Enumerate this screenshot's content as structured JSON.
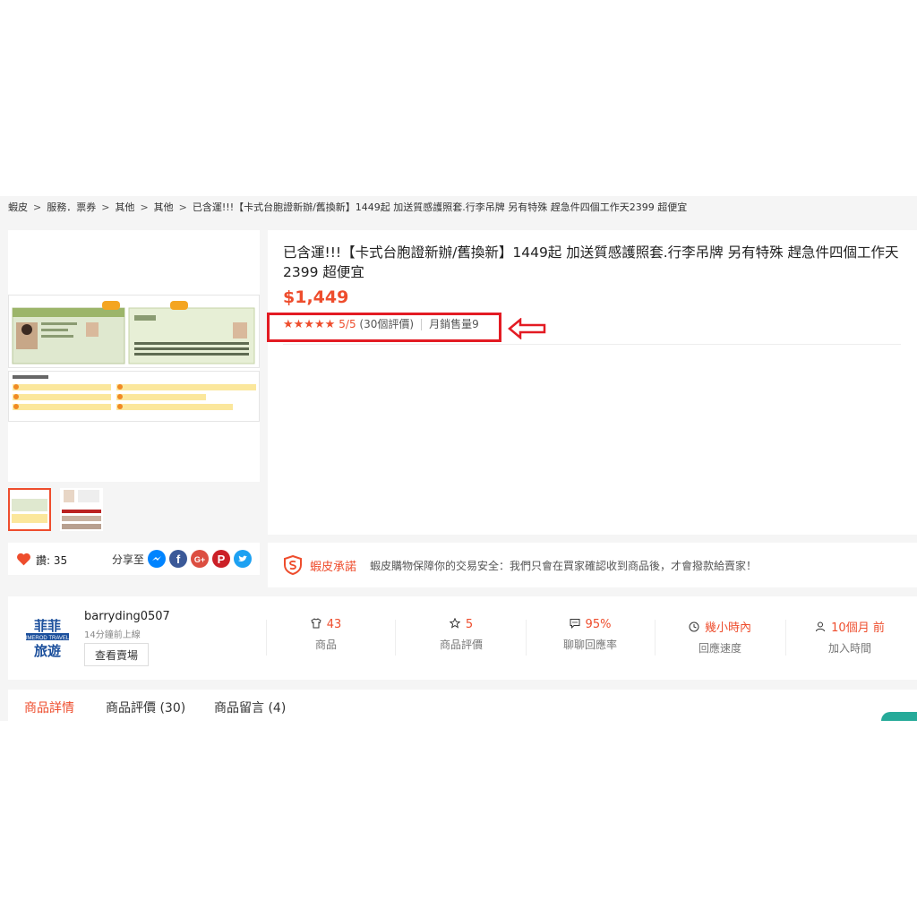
{
  "breadcrumb": {
    "items": [
      "蝦皮",
      "服務．票券",
      "其他",
      "其他",
      "已含運!!!【卡式台胞證新辦/舊換新】1449起 加送質感護照套.行李吊牌 另有特殊 趕急件四個工作天2399 超便宜"
    ]
  },
  "product": {
    "title": "已含運!!!【卡式台胞證新辦/舊換新】1449起 加送質感護照套.行李吊牌 另有特殊 趕急件四個工作天2399 超便宜",
    "price": "$1,449",
    "rating_value": 5,
    "rating_max": 5,
    "rating_text": "5/5",
    "reviews_text": "(30個評價)",
    "monthly_sales": "月銷售量9"
  },
  "like_bar": {
    "likes": "讚: 35",
    "share_label": "分享至"
  },
  "guarantee": {
    "title": "蝦皮承諾",
    "text": "蝦皮購物保障你的交易安全：我們只會在買家確認收到商品後，才會撥款給賣家！"
  },
  "seller": {
    "logo_top": "菲菲",
    "logo_mid": "IMEROD TRAVEL",
    "logo_bottom": "旅遊",
    "name": "barryding0507",
    "online": "14分鐘前上線",
    "view_shop": "查看賣場",
    "stats": [
      {
        "value": "43",
        "label": "商品",
        "icon": "shirt-icon"
      },
      {
        "value": "5",
        "label": "商品評價",
        "icon": "star-outline-icon"
      },
      {
        "value": "95%",
        "label": "聊聊回應率",
        "icon": "chat-icon"
      },
      {
        "value": "幾小時內",
        "label": "回應速度",
        "icon": "clock-icon"
      },
      {
        "value": "10個月 前",
        "label": "加入時間",
        "icon": "user-icon"
      }
    ]
  },
  "tabs": [
    {
      "label": "商品詳情"
    },
    {
      "label": "商品評價 (30)"
    },
    {
      "label": "商品留言 (4)"
    }
  ],
  "colors": {
    "accent": "#ee4d2d",
    "highlight_box": "#e31b23",
    "float_button": "#26aa99"
  }
}
